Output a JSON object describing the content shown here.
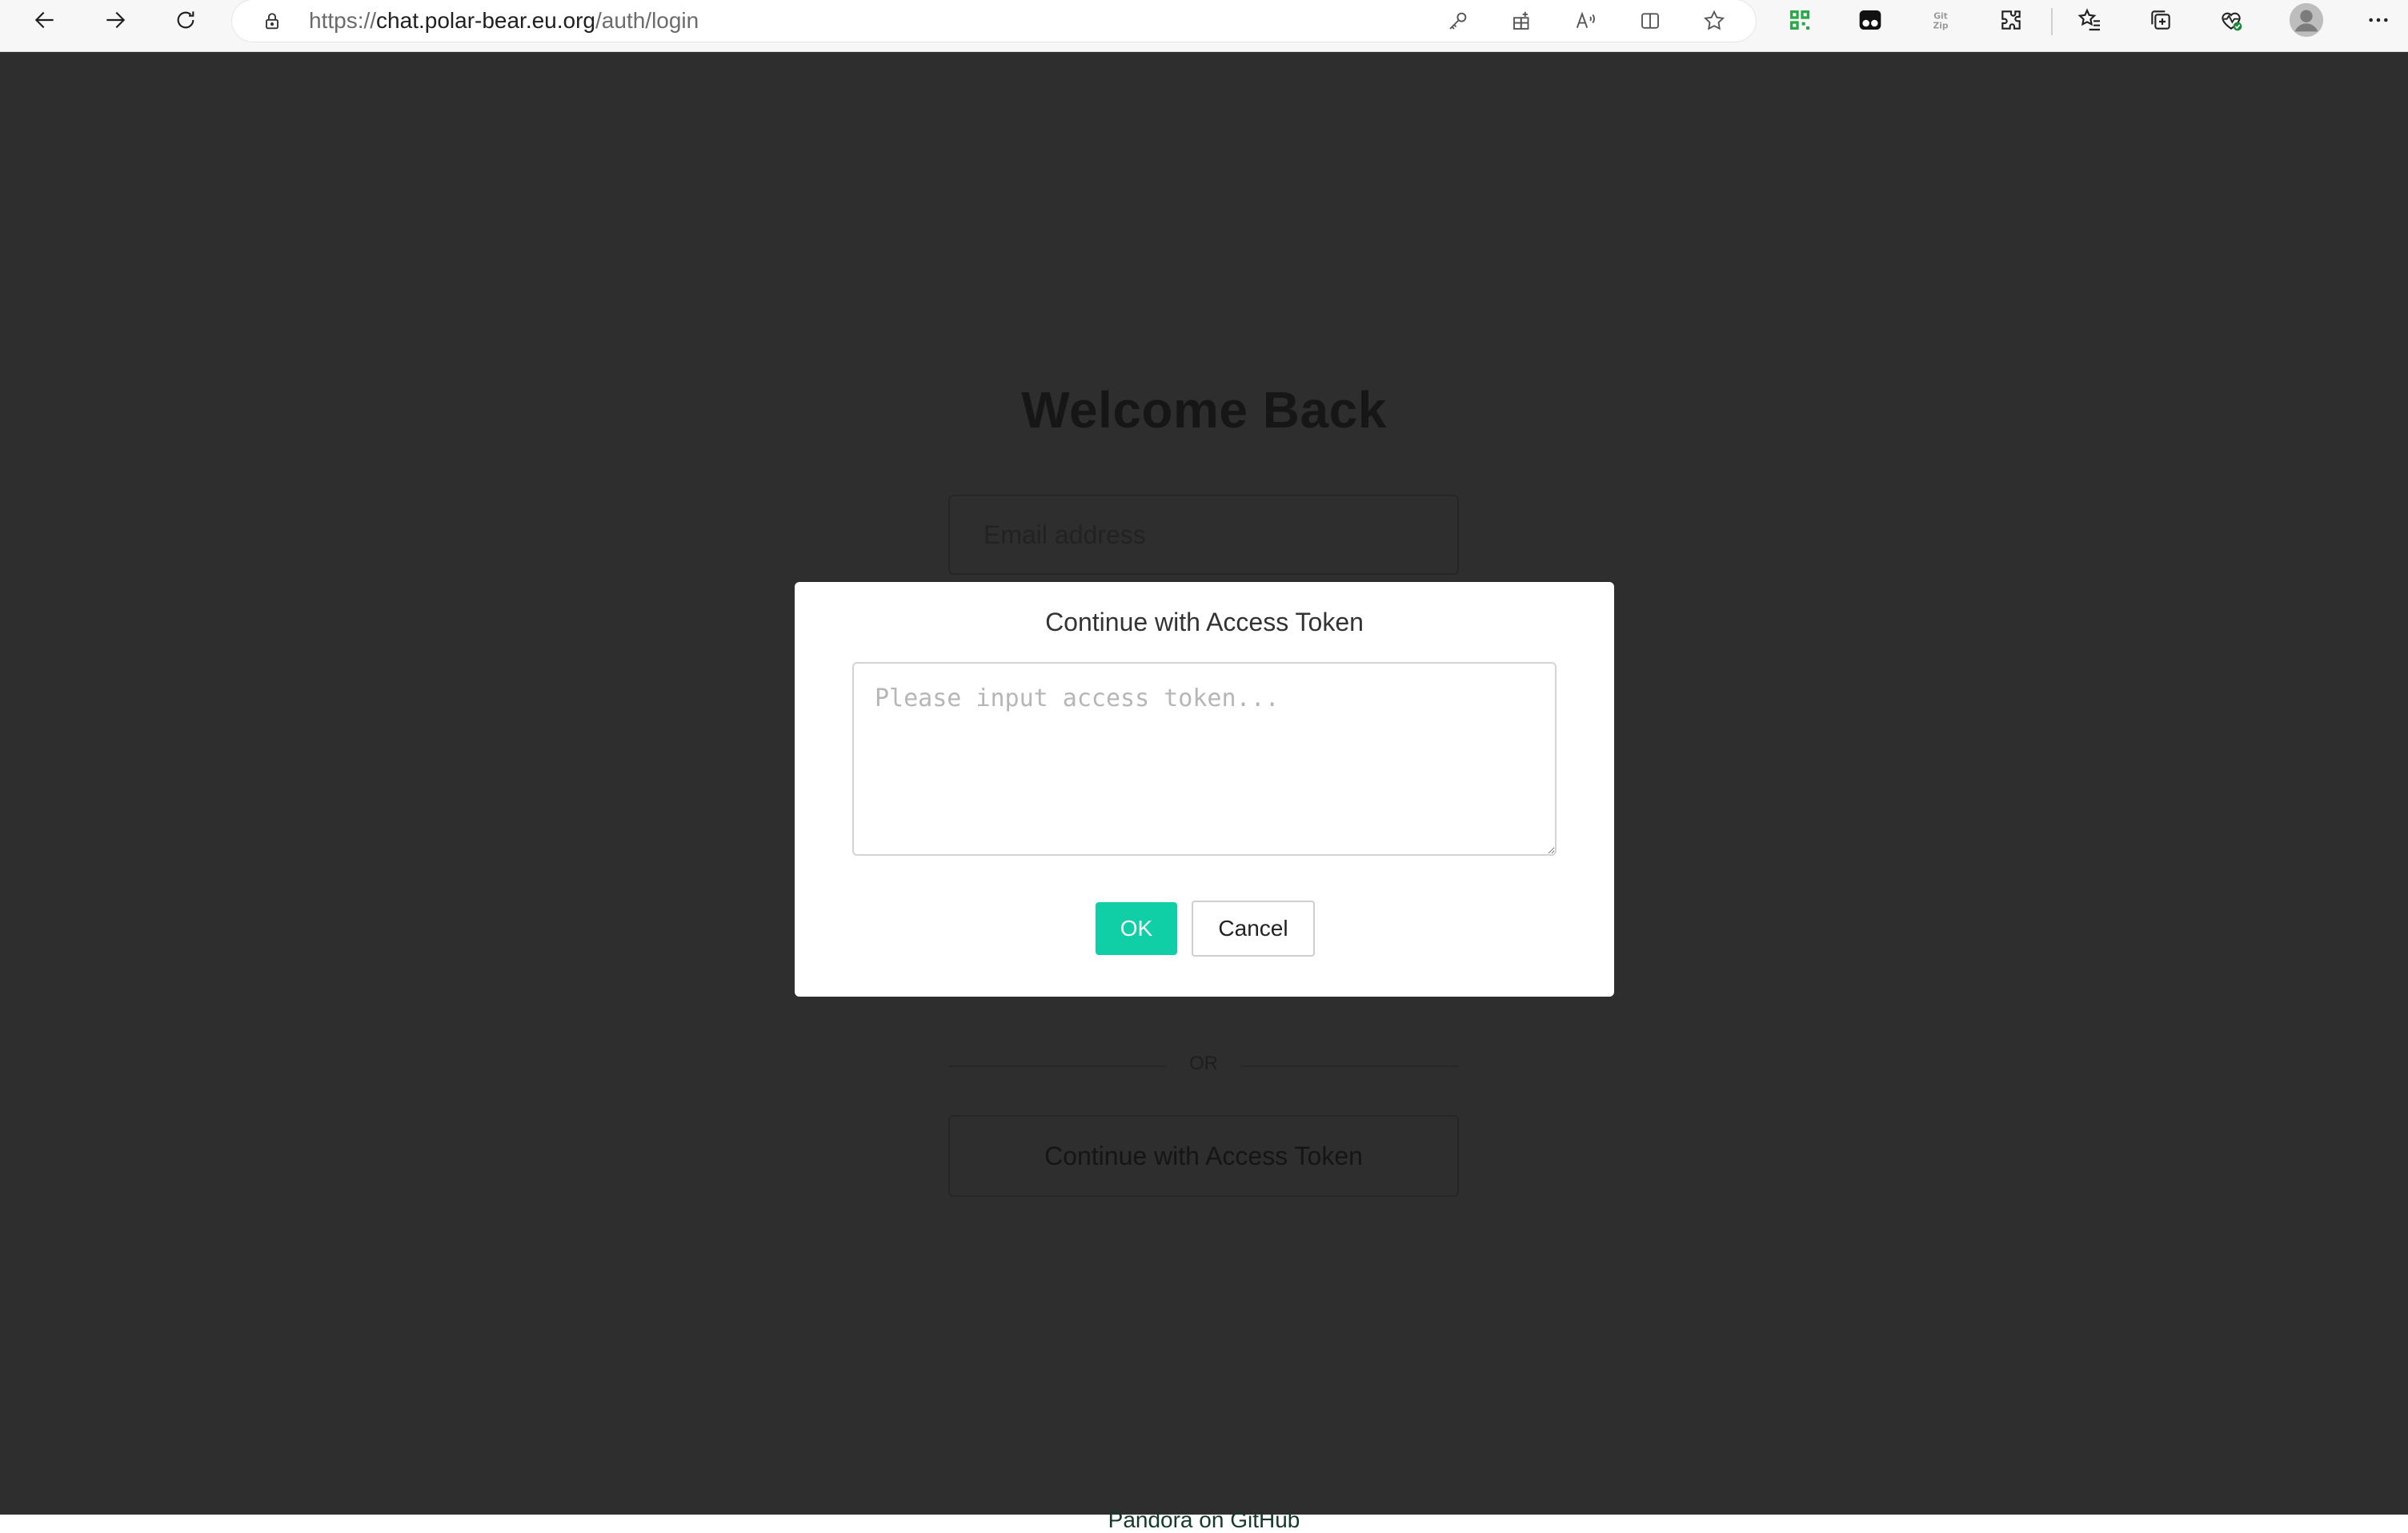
{
  "browser": {
    "url_scheme": "https://",
    "url_host": "chat.polar-bear.eu.org",
    "url_path": "/auth/login",
    "icons": [
      "back-icon",
      "forward-icon",
      "refresh-icon",
      "lock-icon",
      "key-icon",
      "apps-icon",
      "read-aloud-icon",
      "split-screen-icon",
      "favorite-star-icon",
      "qr-extension-icon",
      "tampermonkey-icon",
      "git-zip-icon",
      "extensions-icon",
      "favorites-icon",
      "collections-icon",
      "browser-essentials-icon",
      "profile-avatar-icon",
      "more-icon"
    ]
  },
  "page": {
    "heading": "Welcome Back",
    "email_placeholder": "Email address",
    "divider_text": "OR",
    "token_button_label": "Continue with Access Token",
    "footer_link": "Pandora on GitHub"
  },
  "modal": {
    "title": "Continue with Access Token",
    "input_placeholder": "Please input access token...",
    "ok_label": "OK",
    "cancel_label": "Cancel"
  },
  "colors": {
    "overlay_bg": "#2e2e2e",
    "ok_button": "#10cfa6",
    "modal_bg": "#ffffff"
  }
}
